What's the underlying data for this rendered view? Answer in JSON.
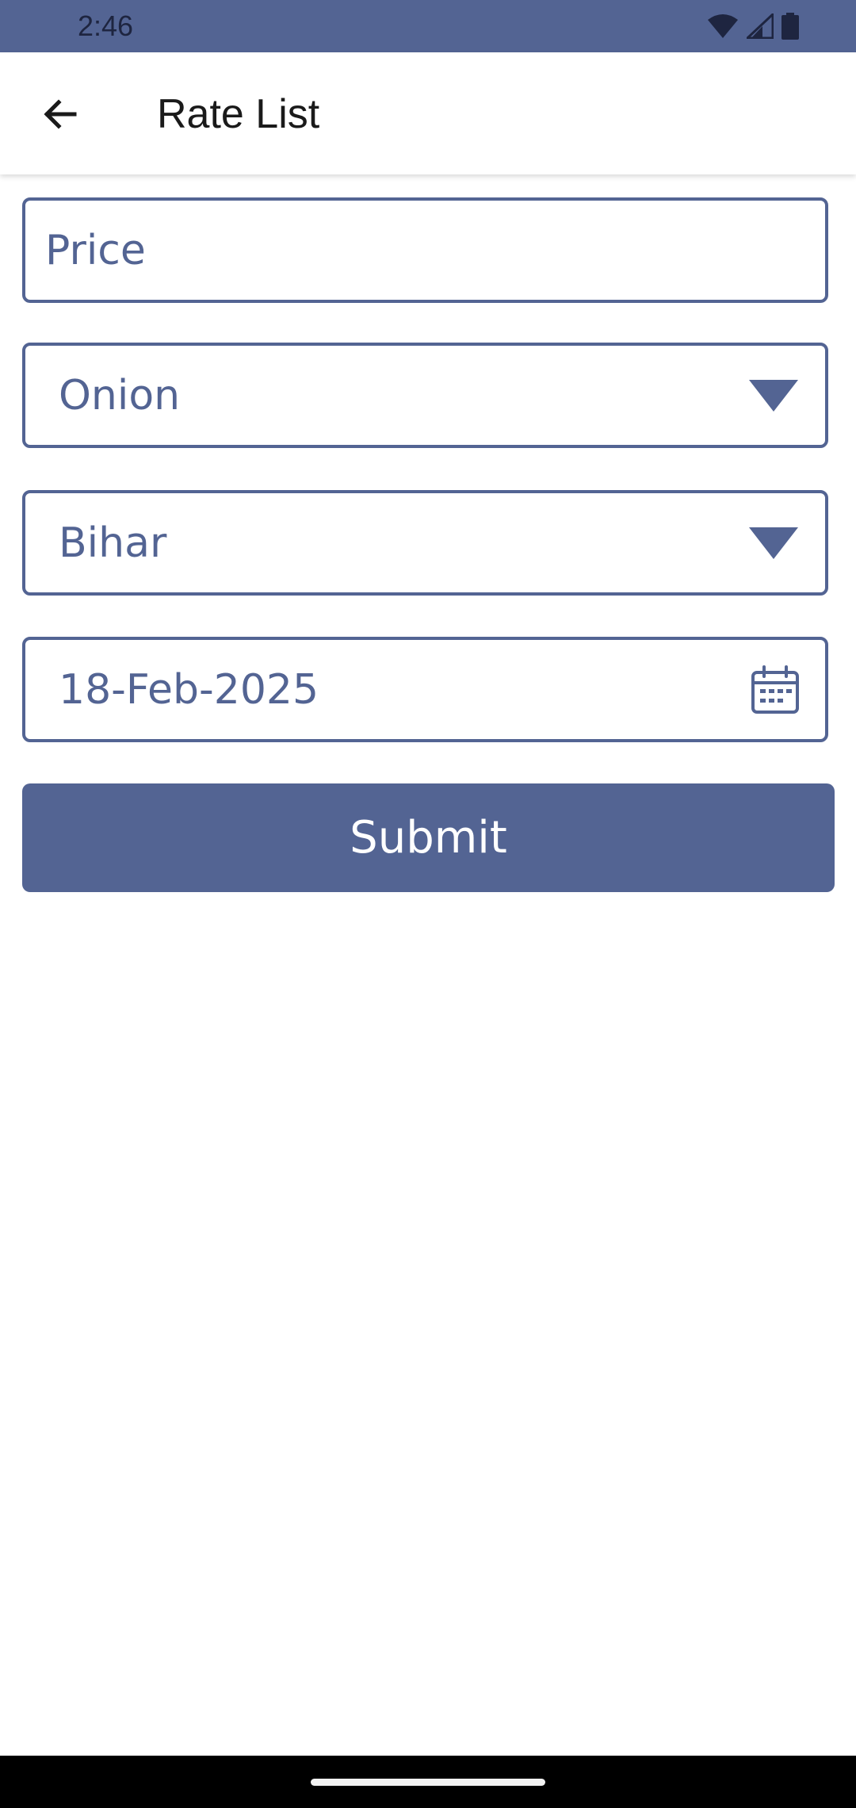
{
  "status_bar": {
    "time": "2:46",
    "icons": [
      "wifi-icon",
      "signal-icon",
      "battery-icon"
    ]
  },
  "app_bar": {
    "title": "Rate List",
    "back_icon": "arrow-back-icon"
  },
  "form": {
    "price": {
      "placeholder": "Price",
      "value": ""
    },
    "commodity": {
      "selected": "Onion",
      "icon": "dropdown-arrow-icon"
    },
    "state": {
      "selected": "Bihar",
      "icon": "dropdown-arrow-icon"
    },
    "date": {
      "value": "18-Feb-2025",
      "icon": "calendar-icon"
    },
    "submit_label": "Submit"
  },
  "colors": {
    "primary": "#536493",
    "status_text": "#1e2540",
    "title_text": "#1a1a1a",
    "nav_bar": "#000000"
  }
}
